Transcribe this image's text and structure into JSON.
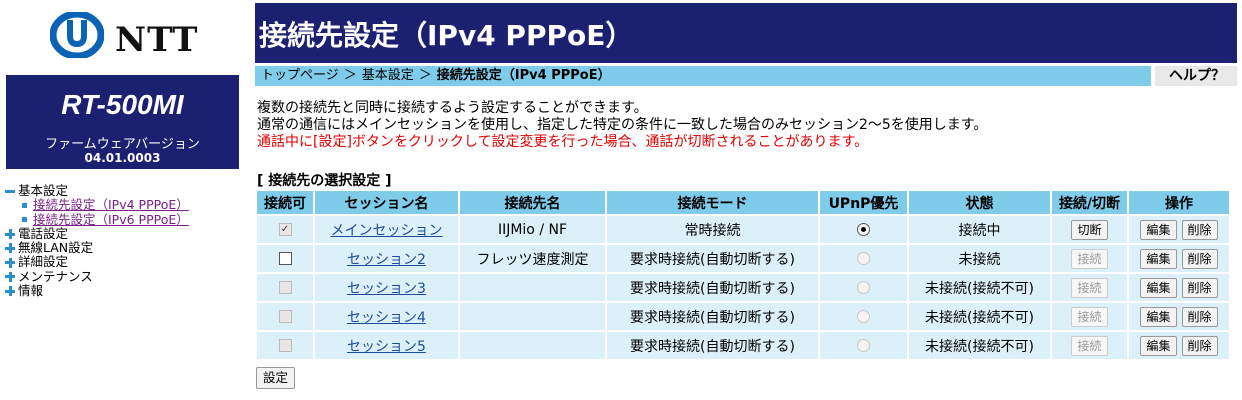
{
  "brand": {
    "logo_text": "NTT"
  },
  "device": {
    "model": "RT-500MI",
    "firmware_label": "ファームウェアバージョン",
    "firmware_version": "04.01.0003"
  },
  "sidenav": {
    "basic": "基本設定",
    "basic_items": [
      "接続先設定（IPv4 PPPoE）",
      "接続先設定（IPv6 PPPoE）"
    ],
    "phone": "電話設定",
    "wlan": "無線LAN設定",
    "detail": "詳細設定",
    "maint": "メンテナンス",
    "info": "情報"
  },
  "page": {
    "title": "接続先設定（IPv4 PPPoE）"
  },
  "breadcrumb": {
    "items": [
      "トップページ",
      "基本設定",
      "接続先設定（IPv4 PPPoE）"
    ],
    "separator": "＞"
  },
  "help": {
    "label": "ヘルプ？"
  },
  "description": {
    "line1": "複数の接続先と同時に接続するよう設定することができます。",
    "line2": "通常の通信にはメインセッションを使用し、指定した特定の条件に一致した場合のみセッション2～5を使用します。",
    "warning": "通話中に[設定]ボタンをクリックして設定変更を行った場合、通話が切断されることがあります。"
  },
  "section": {
    "title": "[ 接続先の選択設定 ]"
  },
  "table": {
    "headers": {
      "enable": "接続可",
      "session": "セッション名",
      "dest": "接続先名",
      "mode": "接続モード",
      "upnp": "UPnP優先",
      "status": "状態",
      "connect": "接続/切断",
      "ops": "操作"
    },
    "rows": [
      {
        "enabled": true,
        "enable_disabled": true,
        "session": "メインセッション",
        "dest": "IIJMio / NF",
        "mode": "常時接続",
        "upnp": true,
        "upnp_disabled": false,
        "status": "接続中",
        "connect_label": "切断",
        "connect_disabled": false,
        "edit": "編集",
        "delete": "削除"
      },
      {
        "enabled": false,
        "enable_disabled": false,
        "session": "セッション2",
        "dest": "フレッツ速度測定",
        "mode": "要求時接続(自動切断する)",
        "upnp": false,
        "upnp_disabled": true,
        "status": "未接続",
        "connect_label": "接続",
        "connect_disabled": true,
        "edit": "編集",
        "delete": "削除"
      },
      {
        "enabled": false,
        "enable_disabled": true,
        "session": "セッション3",
        "dest": "",
        "mode": "要求時接続(自動切断する)",
        "upnp": false,
        "upnp_disabled": true,
        "status": "未接続(接続不可)",
        "connect_label": "接続",
        "connect_disabled": true,
        "edit": "編集",
        "delete": "削除"
      },
      {
        "enabled": false,
        "enable_disabled": true,
        "session": "セッション4",
        "dest": "",
        "mode": "要求時接続(自動切断する)",
        "upnp": false,
        "upnp_disabled": true,
        "status": "未接続(接続不可)",
        "connect_label": "接続",
        "connect_disabled": true,
        "edit": "編集",
        "delete": "削除"
      },
      {
        "enabled": false,
        "enable_disabled": true,
        "session": "セッション5",
        "dest": "",
        "mode": "要求時接続(自動切断する)",
        "upnp": false,
        "upnp_disabled": true,
        "status": "未接続(接続不可)",
        "connect_label": "接続",
        "connect_disabled": true,
        "edit": "編集",
        "delete": "削除"
      }
    ]
  },
  "submit": {
    "label": "設定"
  },
  "colors": {
    "header_navy": "#1b2070",
    "header_cell": "#7ecbea",
    "data_cell": "#dcf0f9",
    "warning": "#e00000",
    "nav_icon": "#2a8fd0"
  }
}
